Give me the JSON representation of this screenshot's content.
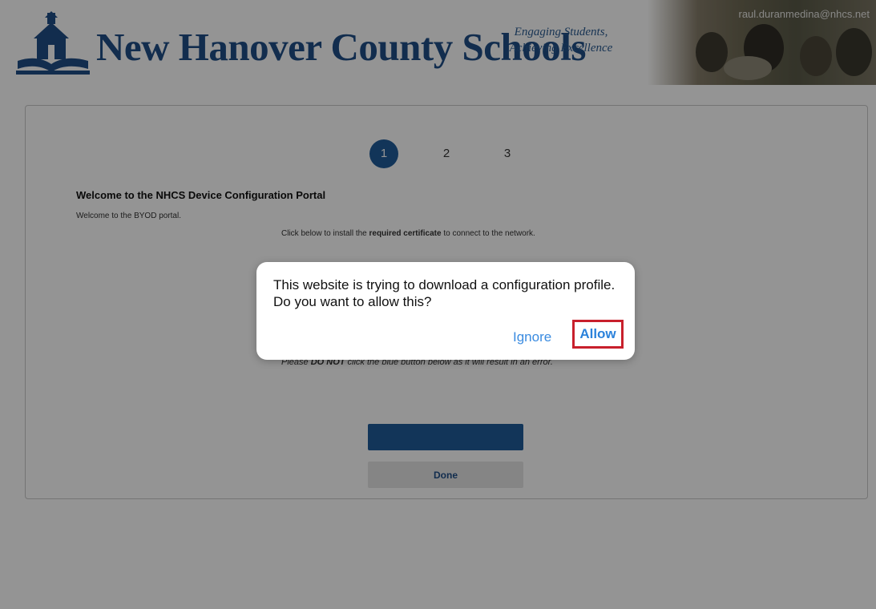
{
  "header": {
    "title": "New Hanover County Schools",
    "tagline_line1": "Engaging Students,",
    "tagline_line2": "Achieving Excellence",
    "user_email": "raul.duranmedina@nhcs.net"
  },
  "steps": [
    "1",
    "2",
    "3"
  ],
  "active_step": 1,
  "portal": {
    "title": "Welcome to the NHCS Device Configuration Portal",
    "subtitle": "Welcome to the BYOD portal.",
    "instruction_pre": "Click below to install the ",
    "instruction_bold": "required certificate",
    "instruction_post": " to connect to the network.",
    "warning_pre": "Please ",
    "warning_bold": "DO NOT",
    "warning_post": " click the blue button below as it will result in an error.",
    "done_label": "Done"
  },
  "dialog": {
    "message": "This website is trying to download a configuration profile. Do you want to allow this?",
    "ignore_label": "Ignore",
    "allow_label": "Allow"
  },
  "colors": {
    "brand_blue": "#1f5c99",
    "link_blue": "#3a8be0",
    "highlight_red": "#c8202c"
  }
}
